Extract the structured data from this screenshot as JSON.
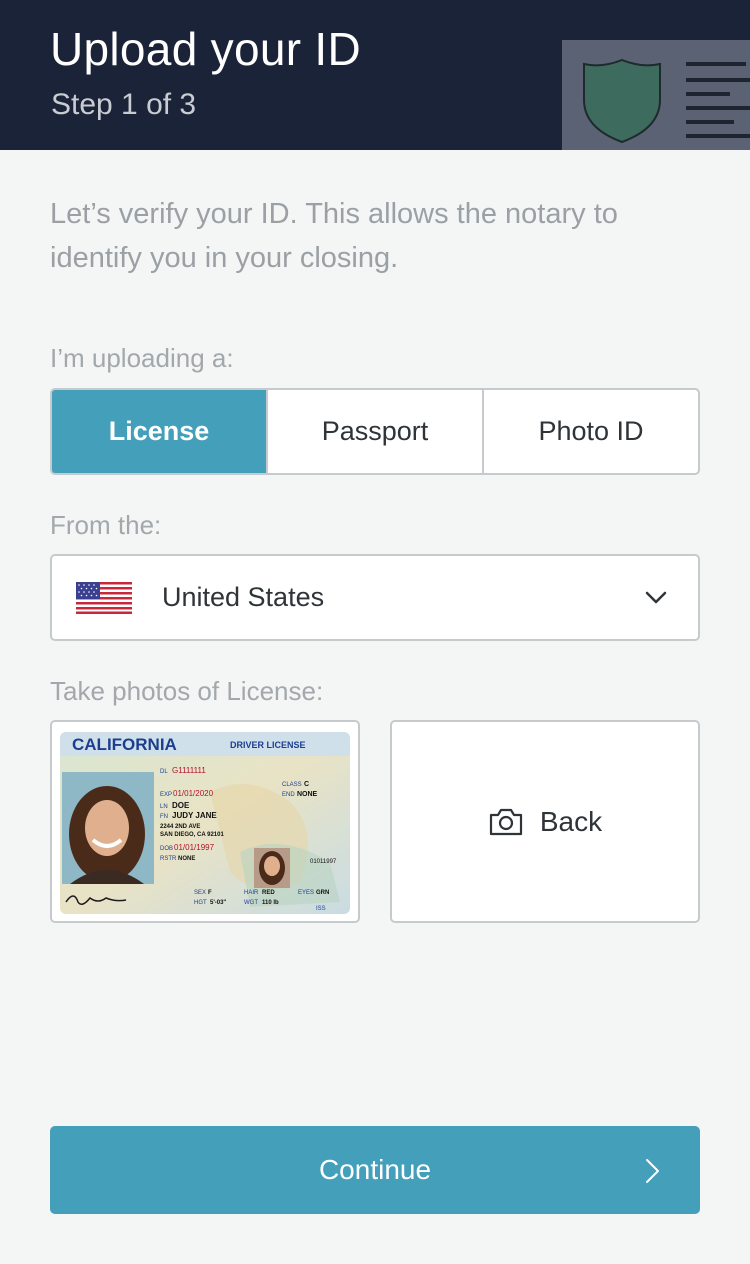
{
  "header": {
    "title": "Upload your ID",
    "step": "Step 1 of 3",
    "illustration_icon": "shield-document-icon"
  },
  "intro": "Let’s verify your ID. This allows the notary to identify you in your closing.",
  "id_type": {
    "label": "I’m uploading a:",
    "options": [
      "License",
      "Passport",
      "Photo ID"
    ],
    "selected": "License"
  },
  "country": {
    "label": "From the:",
    "flag_icon": "us-flag-icon",
    "value": "United States"
  },
  "photos": {
    "label": "Take photos of License:",
    "front": {
      "state": "CALIFORNIA",
      "doc_type": "DRIVER LICENSE",
      "dl": "G1111111",
      "exp": "01/01/2020",
      "last_name": "DOE",
      "first_name": "JUDY JANE",
      "address1": "2244 2ND AVE",
      "address2": "SAN DIEGO, CA 92101",
      "dob": "01/01/1997",
      "rstr": "NONE",
      "class": "C",
      "end": "NONE",
      "sex": "F",
      "hgt": "5'-03\"",
      "hair": "RED",
      "wgt": "110 lb",
      "eyes": "GRN",
      "iss": "ISS",
      "side_number": "01011997"
    },
    "back_label": "Back"
  },
  "continue_label": "Continue",
  "colors": {
    "header_bg": "#1b2338",
    "accent": "#449fba",
    "page_bg": "#f3f6f5"
  }
}
